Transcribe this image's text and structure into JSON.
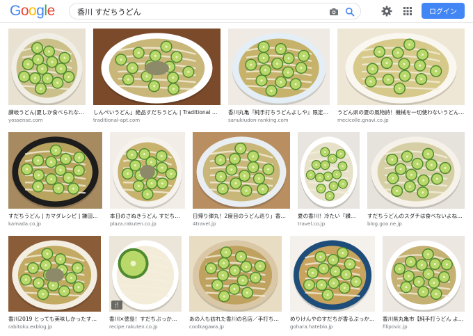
{
  "header": {
    "logo_letters": [
      "G",
      "o",
      "o",
      "g",
      "l",
      "e"
    ],
    "logo_colors": [
      "#4285f4",
      "#ea4335",
      "#fbbc05",
      "#4285f4",
      "#34a853",
      "#ea4335"
    ],
    "search_value": "香川 すだちうどん",
    "login_label": "ログイン",
    "icons": [
      "camera-icon",
      "search-icon",
      "gear-icon",
      "apps-icon"
    ],
    "accent_color": "#4285f4"
  },
  "results": [
    {
      "caption": "讃岐うどん|夏しか食べられな…",
      "source": "yossense.com"
    },
    {
      "caption": "しんぺいうどん」絶品すだちうどん | Traditional Ap…",
      "source": "traditional-apt.com"
    },
    {
      "caption": "香川丸亀『純手打ちうどんよしや』限定…",
      "source": "sanukiudon-ranking.com"
    },
    {
      "caption": "うどん県の夏の風物詩！機械を一切使わないうどん…",
      "source": "mecicolle.gnavi.co.jp"
    },
    {
      "caption": "すだちうどん | カマダレシピ | 鎌田…",
      "source": "kamada.co.jp"
    },
    {
      "caption": "本日のさぬきうどん すだち…",
      "source": "plaza.rakuten.co.jp"
    },
    {
      "caption": "日帰り弾丸！2度目のうどん巡り」香…",
      "source": "4travel.jp"
    },
    {
      "caption": "夏の香川！冷たい『讃…",
      "source": "travel.co.jp"
    },
    {
      "caption": "すだちうどんのスダチは食べないよね…",
      "source": "blog.goo.ne.jp"
    },
    {
      "caption": "香川2019 とっても美味しかったすだ…",
      "source": "rabitoku.exblog.jp"
    },
    {
      "caption": "香川×徳島！すだちぶっか…",
      "source": "recipe.rakuten.co.jp"
    },
    {
      "caption": "あの人も訪れた香川の名店／手打ち…",
      "source": "coolkagawa.jp"
    },
    {
      "caption": "めりけんやのすだちが香るぶっか…",
      "source": "gohara.hateblo.jp"
    },
    {
      "caption": "香川県丸亀市【純手打うどん よ…",
      "source": "filipovic.jp"
    }
  ],
  "badge_label": "🍴"
}
